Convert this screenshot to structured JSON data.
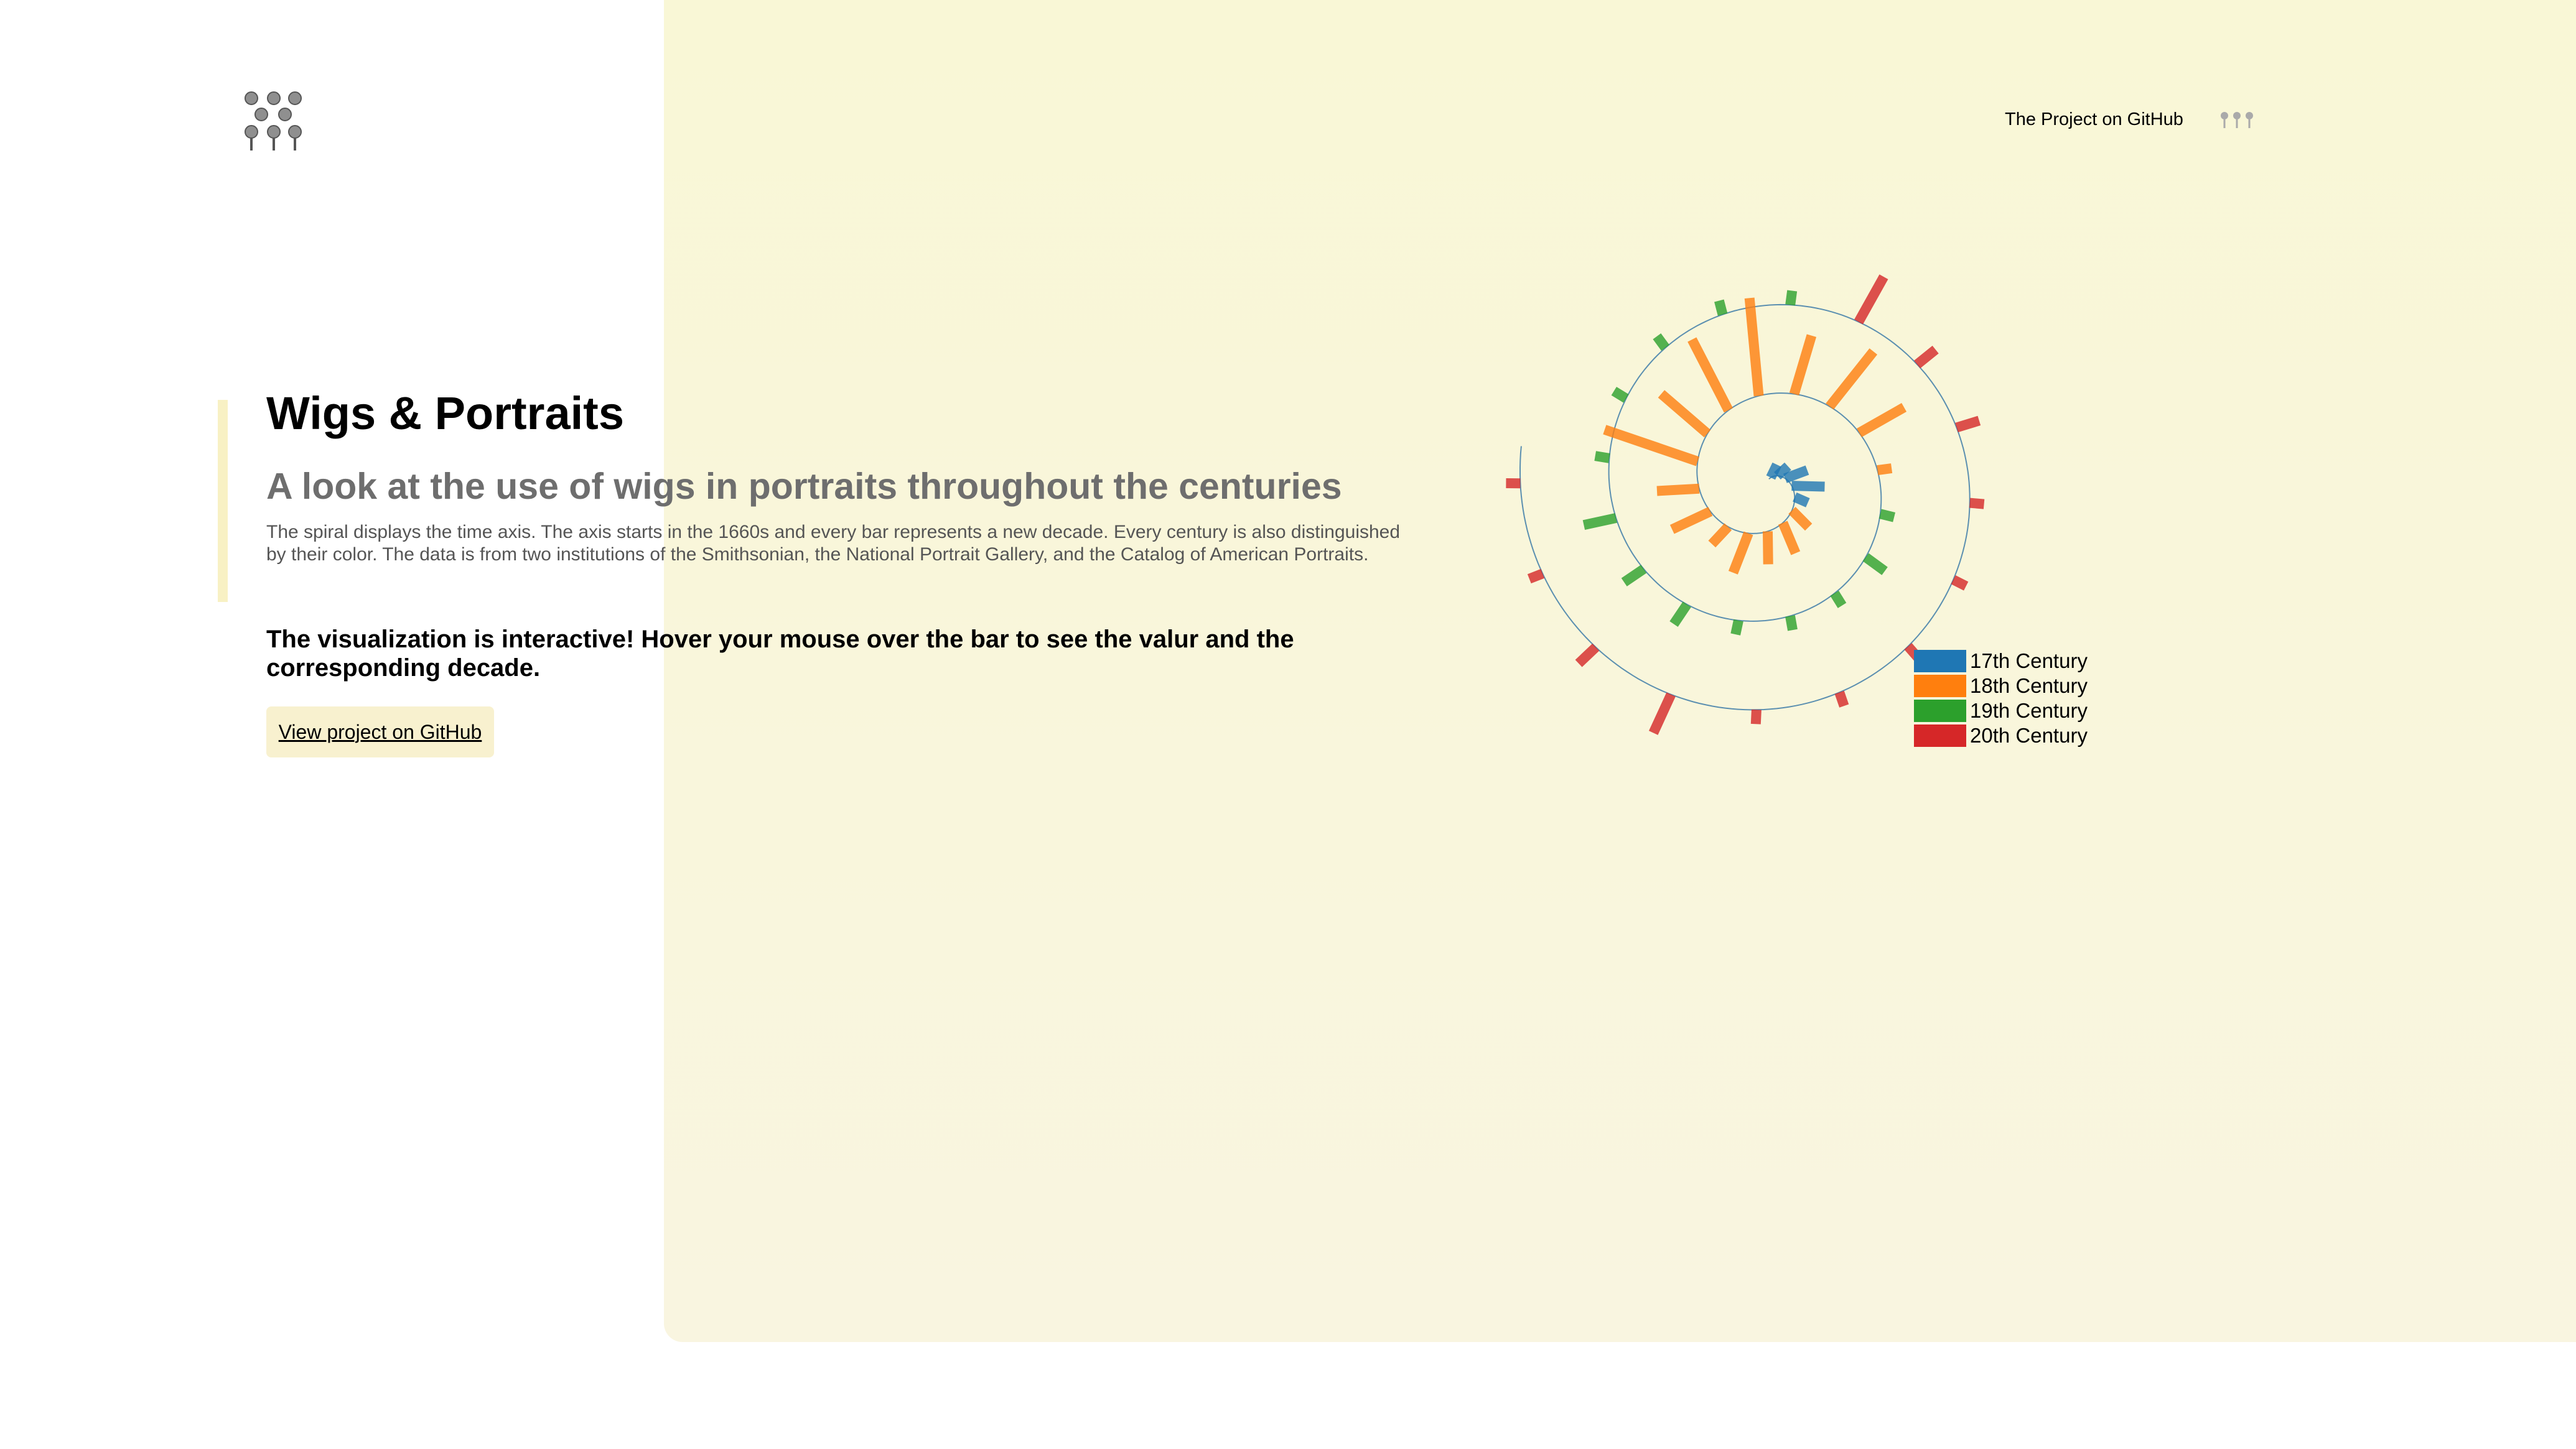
{
  "header": {
    "nav_link": "The Project on GitHub"
  },
  "intro": {
    "title": "Wigs & Portraits",
    "subtitle": "A look at the use of wigs in portraits throughout the centuries",
    "description": "The spiral displays the time axis. The axis starts in the 1660s and every bar represents a new decade. Every century is also distinguished by their color. The data is from two institutions of the Smithsonian, the National Portrait Gallery, and the Catalog of American Portraits.",
    "interactive_note": "The visualization is interactive! Hover your mouse over the bar to see the valur and the corresponding decade.",
    "cta_label": "View project on GitHub"
  },
  "icons": {
    "logo": "wig-portraits-logo-icon",
    "nav": "wig-heads-icon"
  },
  "colors": {
    "axis": "#5b8fb0",
    "accent_bar": "#f8f1c4",
    "cta_bg": "#f8f1cf"
  },
  "legend": [
    {
      "label": "17th Century",
      "color": "#1f77b4"
    },
    {
      "label": "18th Century",
      "color": "#ff7f0e"
    },
    {
      "label": "19th Century",
      "color": "#2ca02c"
    },
    {
      "label": "20th Century",
      "color": "#d62728"
    }
  ],
  "chart_data": {
    "type": "spiral-bar",
    "title": "",
    "x_start": "1660s",
    "decades_per_bar": 1,
    "series": [
      {
        "name": "17th Century",
        "color": "#1f77b4",
        "values": [
          1,
          1,
          2,
          3,
          1
        ]
      },
      {
        "name": "18th Century",
        "color": "#ff7f0e",
        "values": [
          2,
          3,
          3,
          4,
          2,
          4,
          4,
          10,
          6,
          8,
          10,
          6,
          7,
          5,
          1
        ]
      },
      {
        "name": "19th Century",
        "color": "#2ca02c",
        "values": [
          1,
          2,
          1,
          1,
          1,
          2,
          2,
          3,
          1,
          1,
          1,
          1,
          1
        ]
      },
      {
        "name": "20th Century",
        "color": "#d62728",
        "values": [
          5,
          2,
          2,
          1,
          1,
          2,
          1,
          1,
          4,
          2,
          1,
          1
        ]
      }
    ]
  }
}
